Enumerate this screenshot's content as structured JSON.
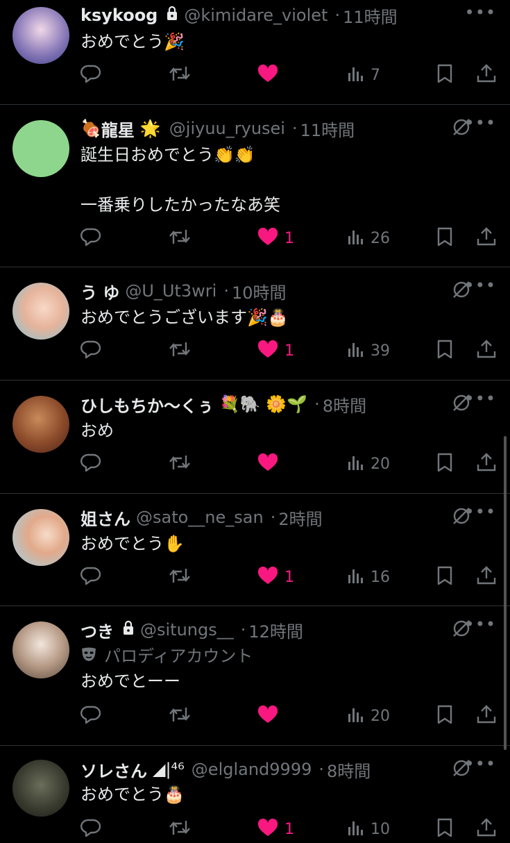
{
  "tweets": [
    {
      "name": "ksykoog",
      "locked": true,
      "handle": "@kimidare_violet",
      "time": "11時間",
      "text": "おめでとう",
      "text_emoji": "🎉",
      "likes": "",
      "liked": true,
      "views": "7"
    },
    {
      "name": "龍星",
      "name_prefix_emoji": "🍖",
      "name_suffix_emoji": "🌟",
      "handle": "@jiyuu_ryusei",
      "time": "11時間",
      "text": "誕生日おめでとう",
      "text_emoji": "👏👏",
      "text2": "一番乗りしたかったなあ笑",
      "likes": "1",
      "liked": true,
      "views": "26"
    },
    {
      "name": "う ゆ",
      "handle": "@U_Ut3wri",
      "time": "10時間",
      "text": "おめでとうございます",
      "text_emoji": "🎉🎂",
      "likes": "1",
      "liked": true,
      "views": "39"
    },
    {
      "name": "ひしもちか〜くぅ",
      "name_suffix_emoji": "💐🐘 🌼🌱",
      "handle": "",
      "time": "8時間",
      "text": "おめ",
      "likes": "",
      "liked": true,
      "views": "20"
    },
    {
      "name": "姐さん",
      "handle": "@sato__ne_san",
      "time": "2時間",
      "text": "おめでとう",
      "text_emoji": "✋",
      "likes": "1",
      "liked": true,
      "views": "16"
    },
    {
      "name": "つき",
      "locked": true,
      "handle": "@situngs__",
      "time": "12時間",
      "parody_label": "パロディアカウント",
      "text": "おめでとーー",
      "likes": "",
      "liked": true,
      "views": "20"
    },
    {
      "name": "ソレさん",
      "name_suffix_text": "◢|⁴⁶",
      "handle": "@elgland9999",
      "time": "8時間",
      "text": "おめでとう",
      "text_emoji": "🎂",
      "likes": "1",
      "liked": true,
      "views": "10"
    }
  ],
  "colors": {
    "like": "#f91880",
    "muted": "#71767b",
    "text": "#e7e9ea",
    "divider": "#2f3336"
  },
  "icons": [
    "reply-icon",
    "retweet-icon",
    "heart-icon",
    "views-icon",
    "bookmark-icon",
    "share-icon",
    "grok-icon",
    "more-icon",
    "lock-icon",
    "mask-icon"
  ]
}
